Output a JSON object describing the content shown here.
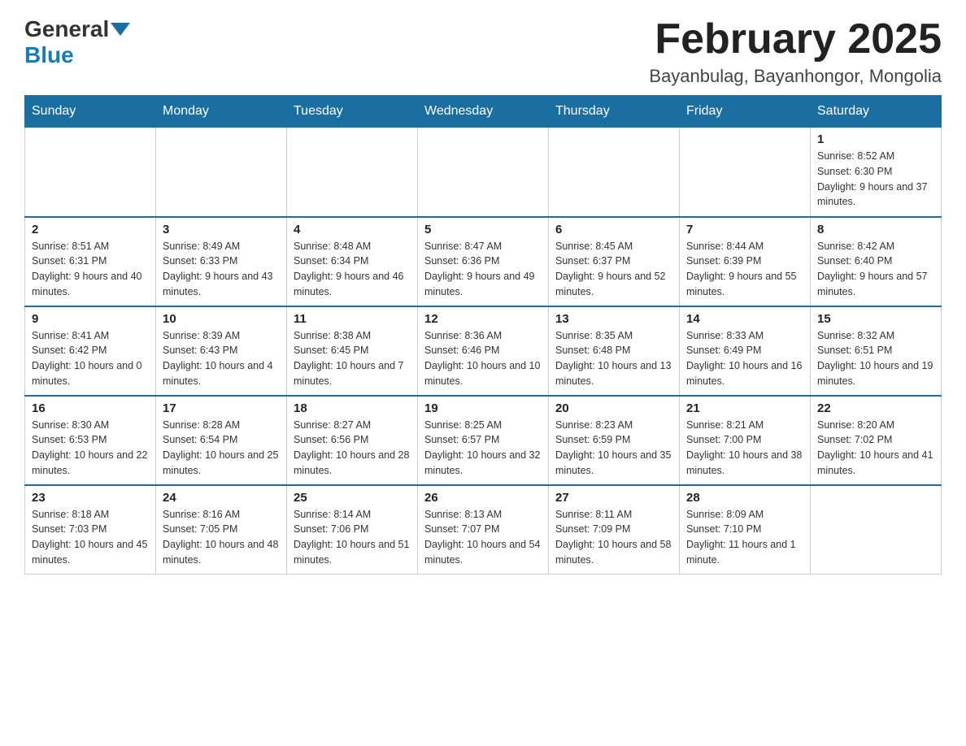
{
  "header": {
    "logo_general": "General",
    "logo_blue": "Blue",
    "title": "February 2025",
    "location": "Bayanbulag, Bayanhongor, Mongolia"
  },
  "weekdays": [
    "Sunday",
    "Monday",
    "Tuesday",
    "Wednesday",
    "Thursday",
    "Friday",
    "Saturday"
  ],
  "weeks": [
    [
      {
        "day": "",
        "info": ""
      },
      {
        "day": "",
        "info": ""
      },
      {
        "day": "",
        "info": ""
      },
      {
        "day": "",
        "info": ""
      },
      {
        "day": "",
        "info": ""
      },
      {
        "day": "",
        "info": ""
      },
      {
        "day": "1",
        "info": "Sunrise: 8:52 AM\nSunset: 6:30 PM\nDaylight: 9 hours and 37 minutes."
      }
    ],
    [
      {
        "day": "2",
        "info": "Sunrise: 8:51 AM\nSunset: 6:31 PM\nDaylight: 9 hours and 40 minutes."
      },
      {
        "day": "3",
        "info": "Sunrise: 8:49 AM\nSunset: 6:33 PM\nDaylight: 9 hours and 43 minutes."
      },
      {
        "day": "4",
        "info": "Sunrise: 8:48 AM\nSunset: 6:34 PM\nDaylight: 9 hours and 46 minutes."
      },
      {
        "day": "5",
        "info": "Sunrise: 8:47 AM\nSunset: 6:36 PM\nDaylight: 9 hours and 49 minutes."
      },
      {
        "day": "6",
        "info": "Sunrise: 8:45 AM\nSunset: 6:37 PM\nDaylight: 9 hours and 52 minutes."
      },
      {
        "day": "7",
        "info": "Sunrise: 8:44 AM\nSunset: 6:39 PM\nDaylight: 9 hours and 55 minutes."
      },
      {
        "day": "8",
        "info": "Sunrise: 8:42 AM\nSunset: 6:40 PM\nDaylight: 9 hours and 57 minutes."
      }
    ],
    [
      {
        "day": "9",
        "info": "Sunrise: 8:41 AM\nSunset: 6:42 PM\nDaylight: 10 hours and 0 minutes."
      },
      {
        "day": "10",
        "info": "Sunrise: 8:39 AM\nSunset: 6:43 PM\nDaylight: 10 hours and 4 minutes."
      },
      {
        "day": "11",
        "info": "Sunrise: 8:38 AM\nSunset: 6:45 PM\nDaylight: 10 hours and 7 minutes."
      },
      {
        "day": "12",
        "info": "Sunrise: 8:36 AM\nSunset: 6:46 PM\nDaylight: 10 hours and 10 minutes."
      },
      {
        "day": "13",
        "info": "Sunrise: 8:35 AM\nSunset: 6:48 PM\nDaylight: 10 hours and 13 minutes."
      },
      {
        "day": "14",
        "info": "Sunrise: 8:33 AM\nSunset: 6:49 PM\nDaylight: 10 hours and 16 minutes."
      },
      {
        "day": "15",
        "info": "Sunrise: 8:32 AM\nSunset: 6:51 PM\nDaylight: 10 hours and 19 minutes."
      }
    ],
    [
      {
        "day": "16",
        "info": "Sunrise: 8:30 AM\nSunset: 6:53 PM\nDaylight: 10 hours and 22 minutes."
      },
      {
        "day": "17",
        "info": "Sunrise: 8:28 AM\nSunset: 6:54 PM\nDaylight: 10 hours and 25 minutes."
      },
      {
        "day": "18",
        "info": "Sunrise: 8:27 AM\nSunset: 6:56 PM\nDaylight: 10 hours and 28 minutes."
      },
      {
        "day": "19",
        "info": "Sunrise: 8:25 AM\nSunset: 6:57 PM\nDaylight: 10 hours and 32 minutes."
      },
      {
        "day": "20",
        "info": "Sunrise: 8:23 AM\nSunset: 6:59 PM\nDaylight: 10 hours and 35 minutes."
      },
      {
        "day": "21",
        "info": "Sunrise: 8:21 AM\nSunset: 7:00 PM\nDaylight: 10 hours and 38 minutes."
      },
      {
        "day": "22",
        "info": "Sunrise: 8:20 AM\nSunset: 7:02 PM\nDaylight: 10 hours and 41 minutes."
      }
    ],
    [
      {
        "day": "23",
        "info": "Sunrise: 8:18 AM\nSunset: 7:03 PM\nDaylight: 10 hours and 45 minutes."
      },
      {
        "day": "24",
        "info": "Sunrise: 8:16 AM\nSunset: 7:05 PM\nDaylight: 10 hours and 48 minutes."
      },
      {
        "day": "25",
        "info": "Sunrise: 8:14 AM\nSunset: 7:06 PM\nDaylight: 10 hours and 51 minutes."
      },
      {
        "day": "26",
        "info": "Sunrise: 8:13 AM\nSunset: 7:07 PM\nDaylight: 10 hours and 54 minutes."
      },
      {
        "day": "27",
        "info": "Sunrise: 8:11 AM\nSunset: 7:09 PM\nDaylight: 10 hours and 58 minutes."
      },
      {
        "day": "28",
        "info": "Sunrise: 8:09 AM\nSunset: 7:10 PM\nDaylight: 11 hours and 1 minute."
      },
      {
        "day": "",
        "info": ""
      }
    ]
  ]
}
